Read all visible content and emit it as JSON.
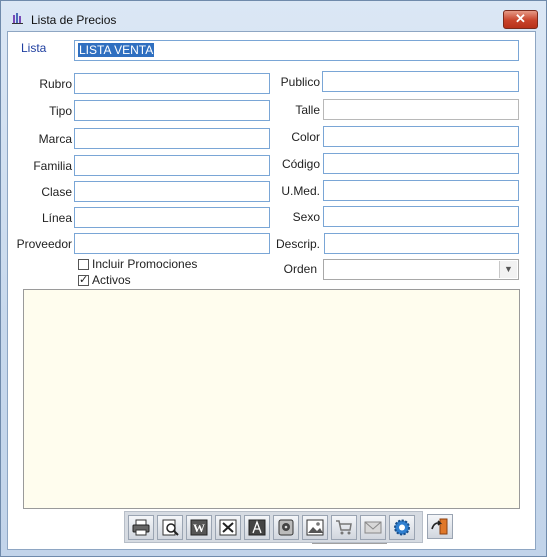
{
  "window": {
    "title": "Lista de Precios",
    "close_label": "✕"
  },
  "lista": {
    "label": "Lista",
    "value": "LISTA VENTA"
  },
  "left_fields": [
    {
      "label": "Rubro",
      "value": ""
    },
    {
      "label": "Tipo",
      "value": ""
    },
    {
      "label": "Marca",
      "value": ""
    },
    {
      "label": "Familia",
      "value": ""
    },
    {
      "label": "Clase",
      "value": ""
    },
    {
      "label": "Línea",
      "value": ""
    },
    {
      "label": "Proveedor",
      "value": ""
    }
  ],
  "right_fields": [
    {
      "label": "Publico",
      "value": ""
    },
    {
      "label": "Talle",
      "value": ""
    },
    {
      "label": "Color",
      "value": ""
    },
    {
      "label": "Código",
      "value": ""
    },
    {
      "label": "U.Med.",
      "value": ""
    },
    {
      "label": "Sexo",
      "value": ""
    },
    {
      "label": "Descrip.",
      "value": ""
    }
  ],
  "options": {
    "incluir_promociones": {
      "label": "Incluir Promociones",
      "checked": false
    },
    "activos": {
      "label": "Activos",
      "checked": true
    }
  },
  "orden": {
    "label": "Orden",
    "value": ""
  },
  "toolbar": {
    "buttons": [
      "print-icon",
      "preview-icon",
      "word-icon",
      "excel-icon",
      "pdf-icon",
      "disk-icon",
      "image-icon",
      "cart-icon",
      "mail-icon",
      "settings-icon",
      "exit-icon"
    ]
  },
  "colors": {
    "accent": "#2f6fc0",
    "grid_bg": "#fffdee",
    "label_blue": "#1f3fa0"
  }
}
